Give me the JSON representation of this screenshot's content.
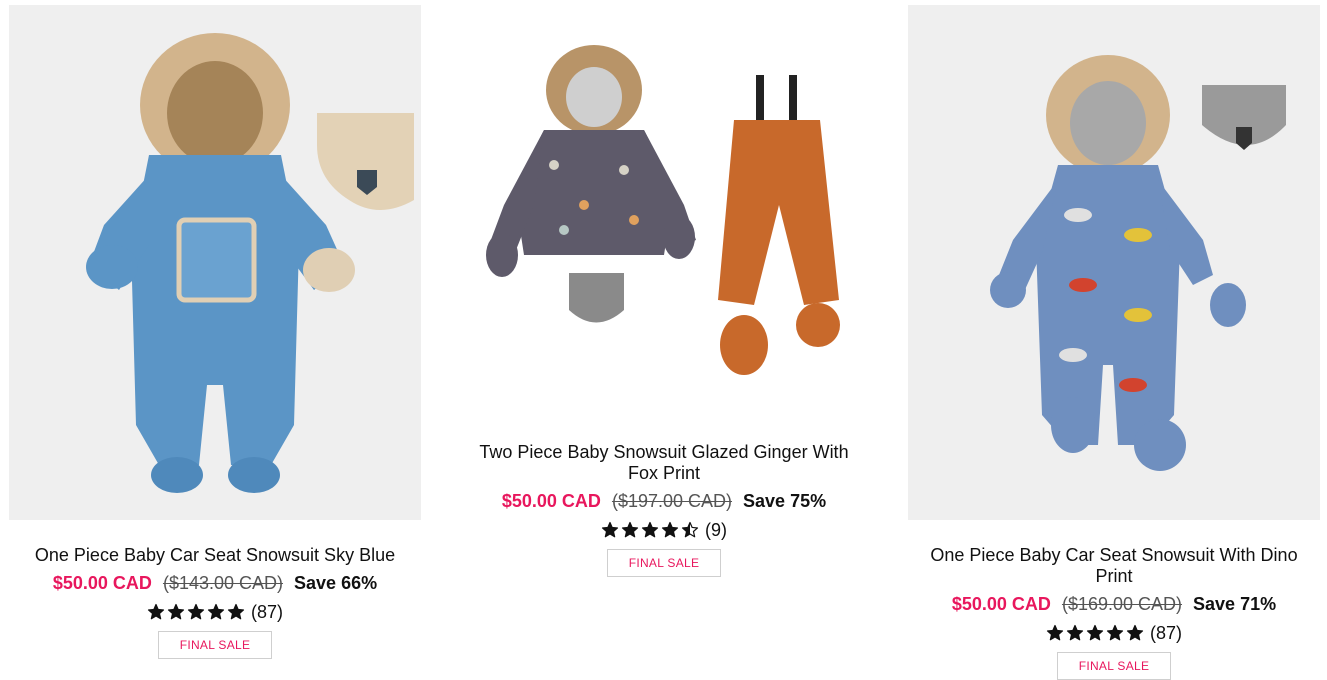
{
  "products": [
    {
      "title": "One Piece Baby Car Seat Snowsuit Sky Blue",
      "sale_price": "$50.00 CAD",
      "original_price": "($143.00 CAD)",
      "save": "Save 66%",
      "rating": 5,
      "review_count": "(87)",
      "badge": "FINAL SALE"
    },
    {
      "title": "Two Piece Baby Snowsuit Glazed Ginger With Fox Print",
      "sale_price": "$50.00 CAD",
      "original_price": "($197.00 CAD)",
      "save": "Save 75%",
      "rating": 4.5,
      "review_count": "(9)",
      "badge": "FINAL SALE"
    },
    {
      "title": "One Piece Baby Car Seat Snowsuit With Dino Print",
      "sale_price": "$50.00 CAD",
      "original_price": "($169.00 CAD)",
      "save": "Save 71%",
      "rating": 5,
      "review_count": "(87)",
      "badge": "FINAL SALE"
    }
  ],
  "colors": {
    "sale": "#e8175d",
    "image_bg": "#efefef",
    "sky_blue": "#5b95c6",
    "ginger": "#c8692b",
    "dino_blue": "#6f8fbf"
  }
}
